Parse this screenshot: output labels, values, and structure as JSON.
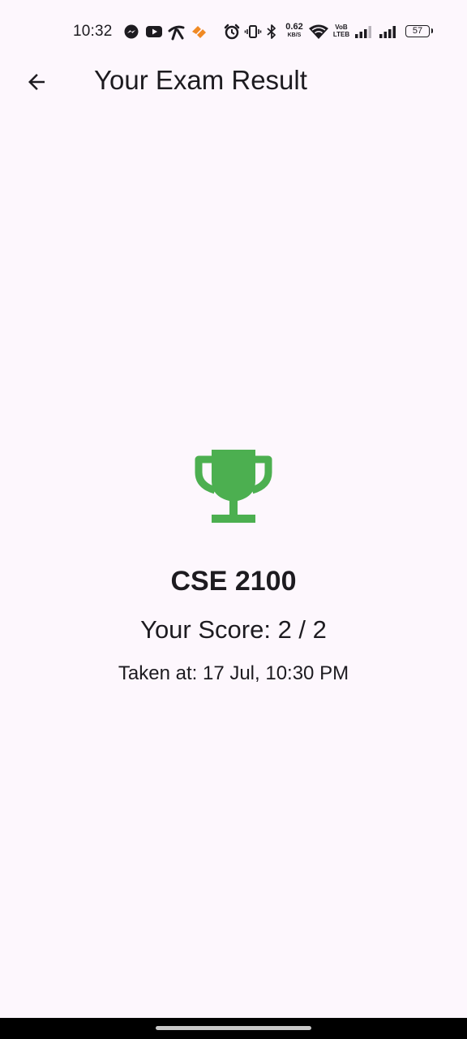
{
  "status_bar": {
    "time": "10:32",
    "net_speed_value": "0.62",
    "net_speed_unit": "KB/S",
    "volte_line1": "VoB",
    "volte_line2": "LTEB",
    "battery_level": "57",
    "notification_icons": [
      "messenger-icon",
      "youtube-icon",
      "telenor-icon",
      "app-notification-icon"
    ],
    "system_icons": [
      "alarm-icon",
      "vibrate-icon",
      "bluetooth-icon",
      "wifi-icon",
      "signal-icon",
      "signal-icon"
    ]
  },
  "app_bar": {
    "back_icon": "arrow-back-icon",
    "title": "Your Exam Result"
  },
  "result": {
    "icon": "trophy-icon",
    "icon_color": "#4caf50",
    "course_code": "CSE 2100",
    "score_text": "Your Score: 2 / 2",
    "taken_at_text": "Taken at: 17 Jul, 10:30 PM"
  },
  "colors": {
    "background": "#fdf7fd",
    "text": "#1d1b20",
    "accent_orange": "#f08a24"
  }
}
